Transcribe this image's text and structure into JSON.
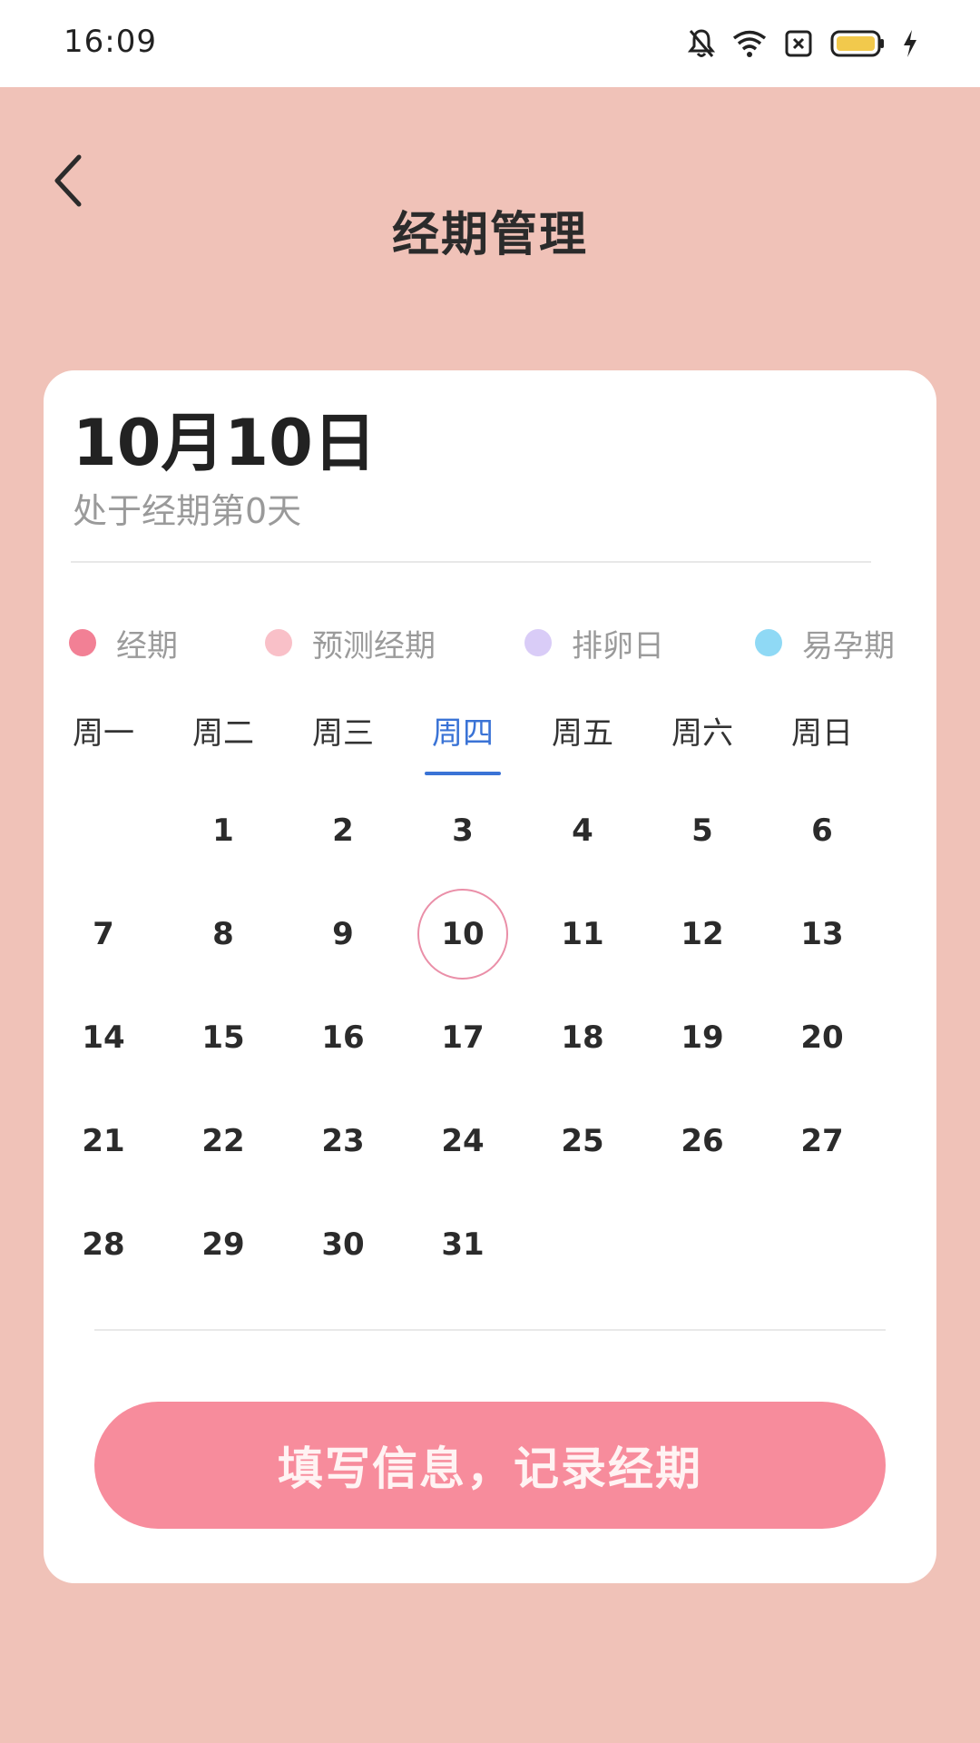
{
  "status_bar": {
    "time": "16:09",
    "icons": [
      "mute-bell-icon",
      "wifi-icon",
      "close-box-icon",
      "battery-icon",
      "charging-bolt-icon"
    ]
  },
  "header": {
    "back_icon": "chevron-left-icon",
    "title": "经期管理"
  },
  "card": {
    "date": "10月10日",
    "status": "处于经期第0天"
  },
  "legend": [
    {
      "label": "经期",
      "color": "#F28095"
    },
    {
      "label": "预测经期",
      "color": "#F9C0C8"
    },
    {
      "label": "排卵日",
      "color": "#D9CCF7"
    },
    {
      "label": "易孕期",
      "color": "#8FD9F5"
    }
  ],
  "weekdays": [
    "周一",
    "周二",
    "周三",
    "周四",
    "周五",
    "周六",
    "周日"
  ],
  "active_weekday_index": 3,
  "calendar": {
    "first_weekday_index": 1,
    "days_in_month": 31,
    "selected_day": 10
  },
  "calendar_days": [
    "1",
    "2",
    "3",
    "4",
    "5",
    "6",
    "7",
    "8",
    "9",
    "10",
    "11",
    "12",
    "13",
    "14",
    "15",
    "16",
    "17",
    "18",
    "19",
    "20",
    "21",
    "22",
    "23",
    "24",
    "25",
    "26",
    "27",
    "28",
    "29",
    "30",
    "31"
  ],
  "record_button": {
    "label": "填写信息，记录经期",
    "color": "#F78C9C"
  },
  "colors": {
    "background": "#F0C2B8",
    "accent_blue": "#3A73D6",
    "today_ring": "#EA8FA8"
  }
}
